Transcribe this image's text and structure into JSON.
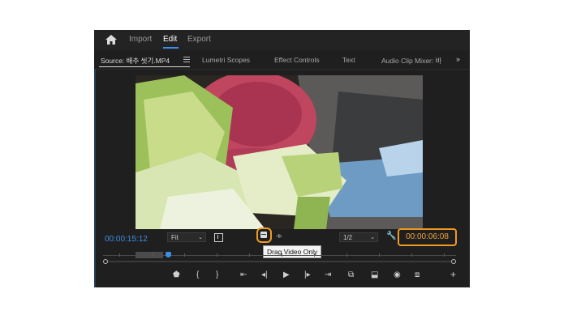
{
  "header": {
    "nav": [
      "Import",
      "Edit",
      "Export"
    ],
    "active": "Edit"
  },
  "tabs": {
    "source": "Source: 배추 씻기.MP4",
    "lumetri": "Lumetri Scopes",
    "effects": "Effect Controls",
    "text": "Text",
    "audio": "Audio Clip Mixer: 바",
    "more": "»"
  },
  "monitor": {
    "current_timecode": "00:00:15:12",
    "zoom": "Fit",
    "resolution": "1/2",
    "duration_timecode": "00:00:06:08",
    "tooltip": "Drag Video Only"
  },
  "colors": {
    "accent": "#3d8ee6",
    "highlight": "#f09a22",
    "panel": "#1f1f1f"
  },
  "icons": [
    "home-icon",
    "panel-menu-icon",
    "bracket-icon",
    "drag-video-only-icon",
    "drag-audio-only-icon",
    "wrench-icon",
    "marker-icon",
    "mark-in-icon",
    "mark-out-icon",
    "go-to-in-icon",
    "step-back-icon",
    "play-icon",
    "step-forward-icon",
    "go-to-out-icon",
    "insert-icon",
    "overwrite-icon",
    "export-frame-icon",
    "button-editor-icon",
    "add-icon"
  ]
}
